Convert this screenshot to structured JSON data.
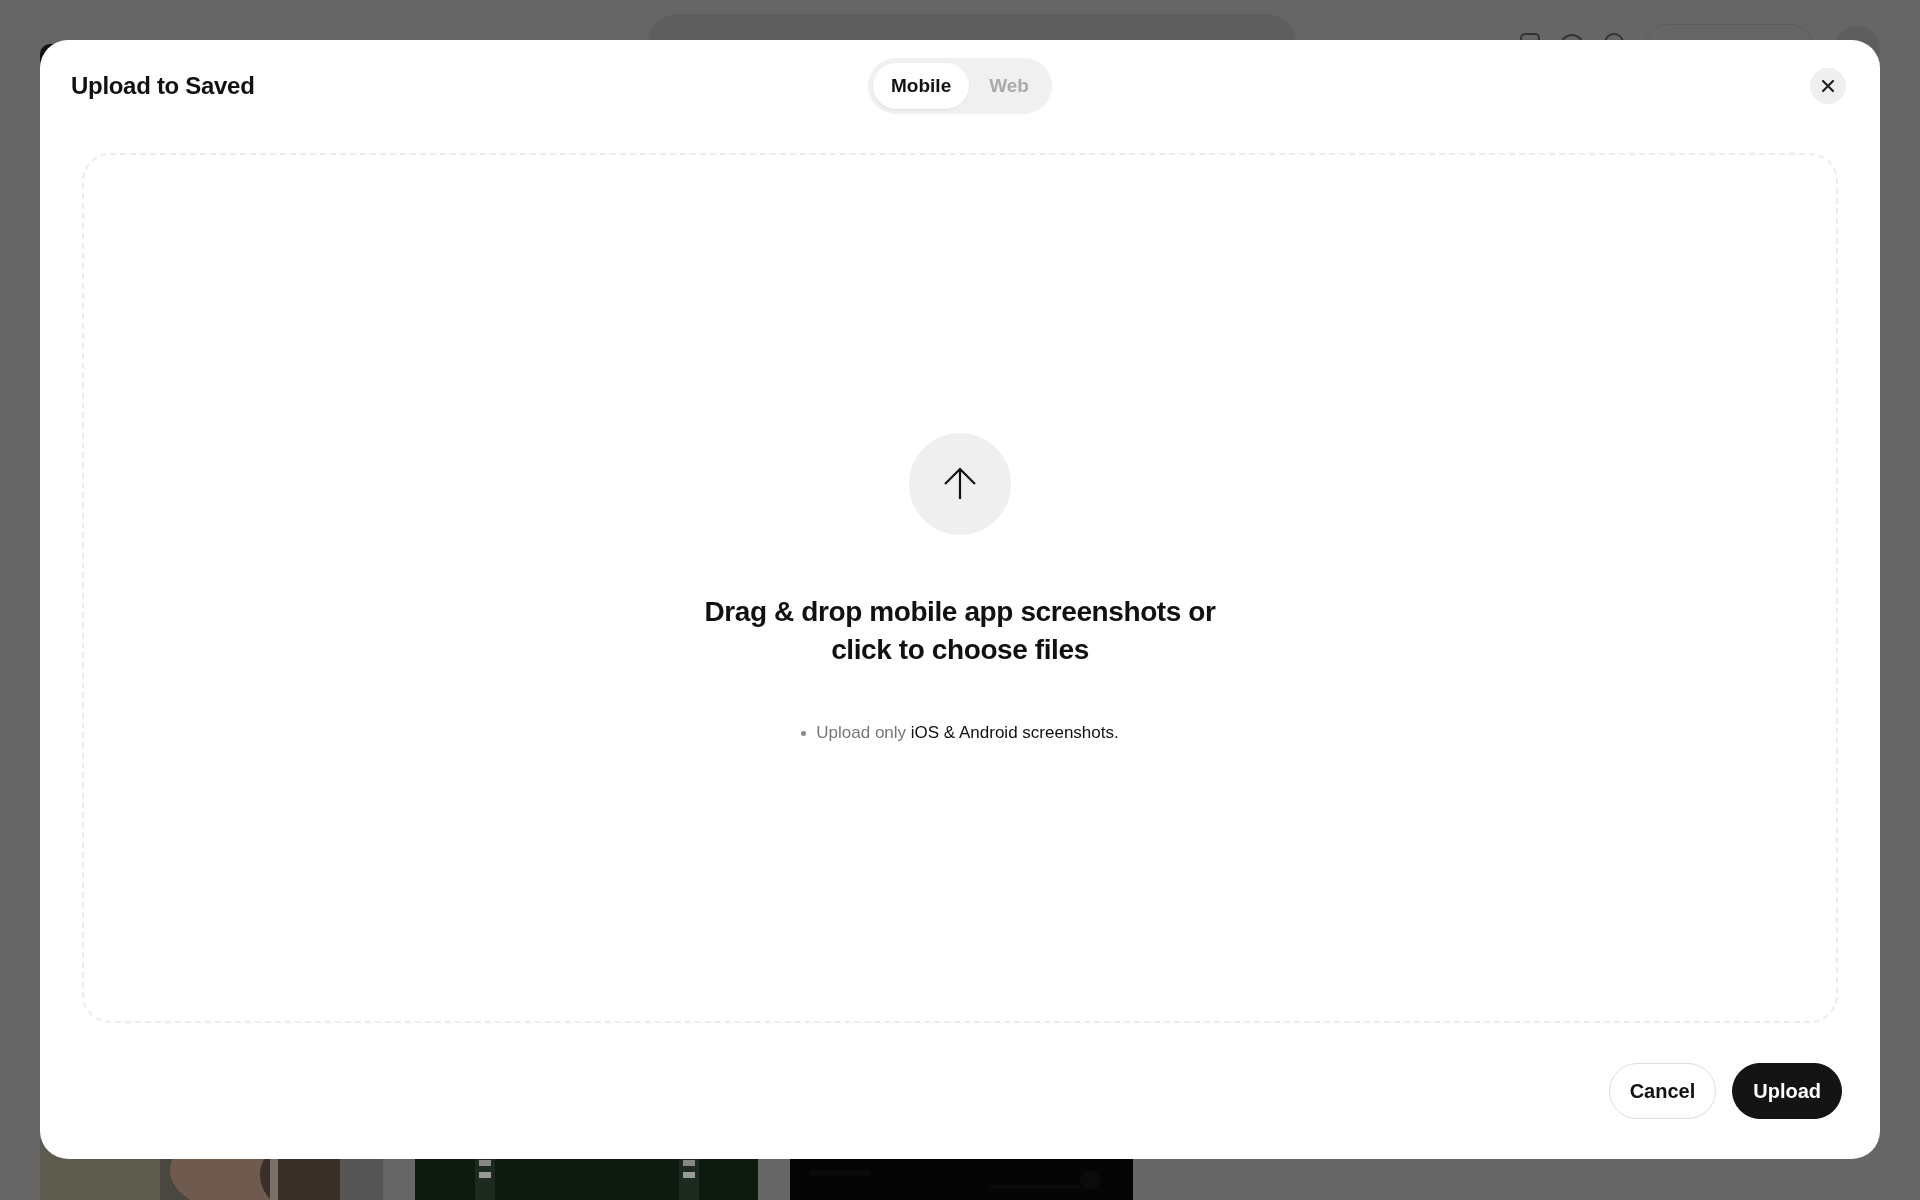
{
  "dialog": {
    "title": "Upload to Saved",
    "tabs": [
      {
        "label": "Mobile",
        "selected": true
      },
      {
        "label": "Web",
        "selected": false
      }
    ],
    "dropzone": {
      "heading": "Drag & drop mobile app screenshots or click to choose files",
      "note_muted": "Upload only",
      "note_emphasis": "iOS & Android screenshots."
    },
    "buttons": [
      {
        "label": "Cancel",
        "kind": "secondary"
      },
      {
        "label": "Upload",
        "kind": "primary"
      }
    ]
  }
}
